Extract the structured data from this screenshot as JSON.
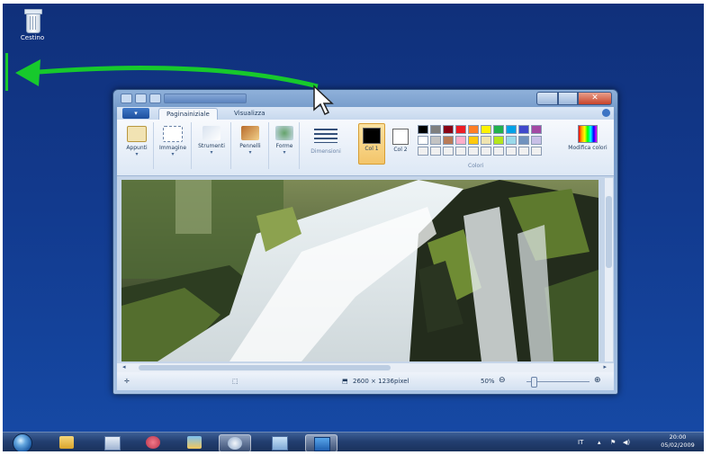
{
  "desktop": {
    "recycle_bin_label": "Cestino"
  },
  "window": {
    "ribbon_tabs": [
      "Paginainiziale",
      "Visualizza"
    ],
    "file_tab_label": "▾",
    "groups": [
      {
        "label": "Appunti"
      },
      {
        "label": "Immagine"
      },
      {
        "label": "Strumenti"
      },
      {
        "label": "Pennelli"
      },
      {
        "label": "Forme"
      },
      {
        "label": "Dimensioni"
      }
    ],
    "color1_label": "Col 1",
    "color2_label": "Col 2",
    "colors_group_label": "Colori",
    "edit_colors_label": "Modifica colori",
    "palette": [
      "#000000",
      "#7f7f7f",
      "#880015",
      "#ed1c24",
      "#ff7f27",
      "#fff200",
      "#22b14c",
      "#00a2e8",
      "#3f48cc",
      "#a349a4",
      "#ffffff",
      "#c3c3c3",
      "#b97a57",
      "#ffaec9",
      "#ffc90e",
      "#efe4b0",
      "#b5e61d",
      "#99d9ea",
      "#7092be",
      "#c8bfe7",
      "#f0f0f0",
      "#f0f0f0",
      "#f0f0f0",
      "#f0f0f0",
      "#f0f0f0",
      "#f0f0f0",
      "#f0f0f0",
      "#f0f0f0",
      "#f0f0f0",
      "#f0f0f0"
    ],
    "status": {
      "dimensions": "2600 × 1236pixel",
      "zoom": "50%"
    }
  },
  "taskbar": {
    "language": "IT",
    "time": "20:00",
    "date": "05/02/2009",
    "pinned_icons": [
      "explorer-icon",
      "paint-icon",
      "pen-icon",
      "folder-icon",
      "media-icon",
      "notepad-icon",
      "monitor-icon"
    ]
  },
  "colors": {
    "desktop_blue": "#123a8e",
    "arrow_green": "#17c92c"
  }
}
